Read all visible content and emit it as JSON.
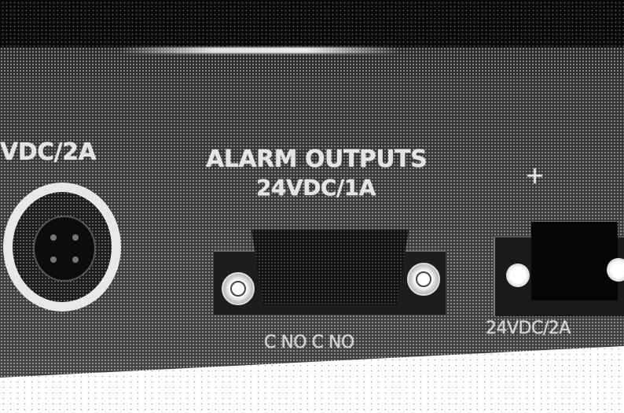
{
  "labels": {
    "power_rating": "VDC/2A",
    "alarm_outputs_line1": "ALARM OUTPUTS",
    "alarm_outputs_line2": "24VDC/1A",
    "plus_sign": "+",
    "pin_legend_db": "C NO C NO",
    "pin_legend_terminal": "24VDC/2A"
  },
  "colors": {
    "panel": "#3a3a3a",
    "surface": "#ffffff",
    "label": "#f2f2f2"
  }
}
